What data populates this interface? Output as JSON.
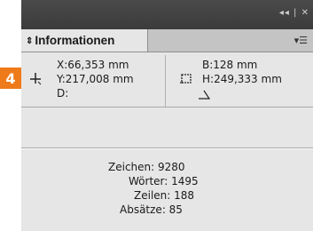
{
  "step_badge": "4",
  "panel": {
    "title": "Informationen",
    "controls": "◂◂ | ✕"
  },
  "position": {
    "x": "X:66,353 mm",
    "y": "Y:217,008 mm",
    "d": "D:"
  },
  "size": {
    "b": "B:128 mm",
    "h": "H:249,333 mm"
  },
  "stats": {
    "zeichen": "Zeichen: 9280",
    "woerter": "Wörter: 1495",
    "zeilen": "Zeilen: 188",
    "absaetze": "Absätze: 85"
  },
  "icons": {
    "position": "crosshair-icon",
    "frame": "frame-size-icon",
    "angle": "angle-icon"
  }
}
